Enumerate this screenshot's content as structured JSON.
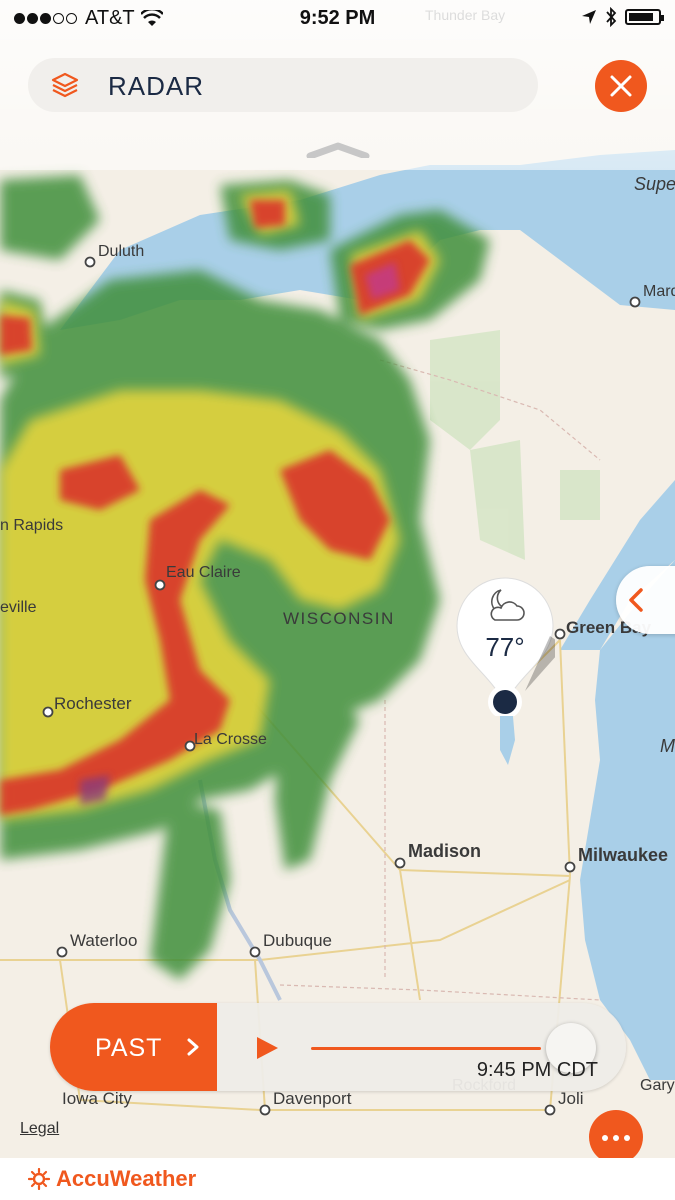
{
  "status_bar": {
    "carrier": "AT&T",
    "time": "9:52 PM",
    "signal_bars_filled": 3,
    "signal_bars_total": 5,
    "battery_level": 0.85
  },
  "header": {
    "title": "RADAR",
    "layers_icon": "layers-icon",
    "close_icon": "close-icon"
  },
  "map": {
    "cities": [
      {
        "name": "Thunder Bay"
      },
      {
        "name": "Duluth"
      },
      {
        "name": "Marq"
      },
      {
        "name": "n Rapids"
      },
      {
        "name": "Eau Claire"
      },
      {
        "name": "eville"
      },
      {
        "name": "Green Bay"
      },
      {
        "name": "Rochester"
      },
      {
        "name": "La Crosse"
      },
      {
        "name": "Madison"
      },
      {
        "name": "Milwaukee"
      },
      {
        "name": "Waterloo"
      },
      {
        "name": "Dubuque"
      },
      {
        "name": "Iowa City"
      },
      {
        "name": "Davenport"
      },
      {
        "name": "Joli"
      },
      {
        "name": "Gary"
      },
      {
        "name": "Rockford"
      }
    ],
    "regions": {
      "state": "WISCONSIN",
      "lake_superior": "Supe",
      "lake_michigan_m": "M"
    }
  },
  "location_pin": {
    "temperature": "77°",
    "weather_icon": "partly-cloudy-night-icon"
  },
  "timeline": {
    "past_label": "PAST",
    "time": "9:45 PM CDT",
    "progress": 0.93
  },
  "footer": {
    "legal_label": "Legal",
    "brand": "AccuWeather"
  },
  "colors": {
    "accent": "#f0581e",
    "land": "#f4efe6",
    "water": "#a9cfe8"
  }
}
